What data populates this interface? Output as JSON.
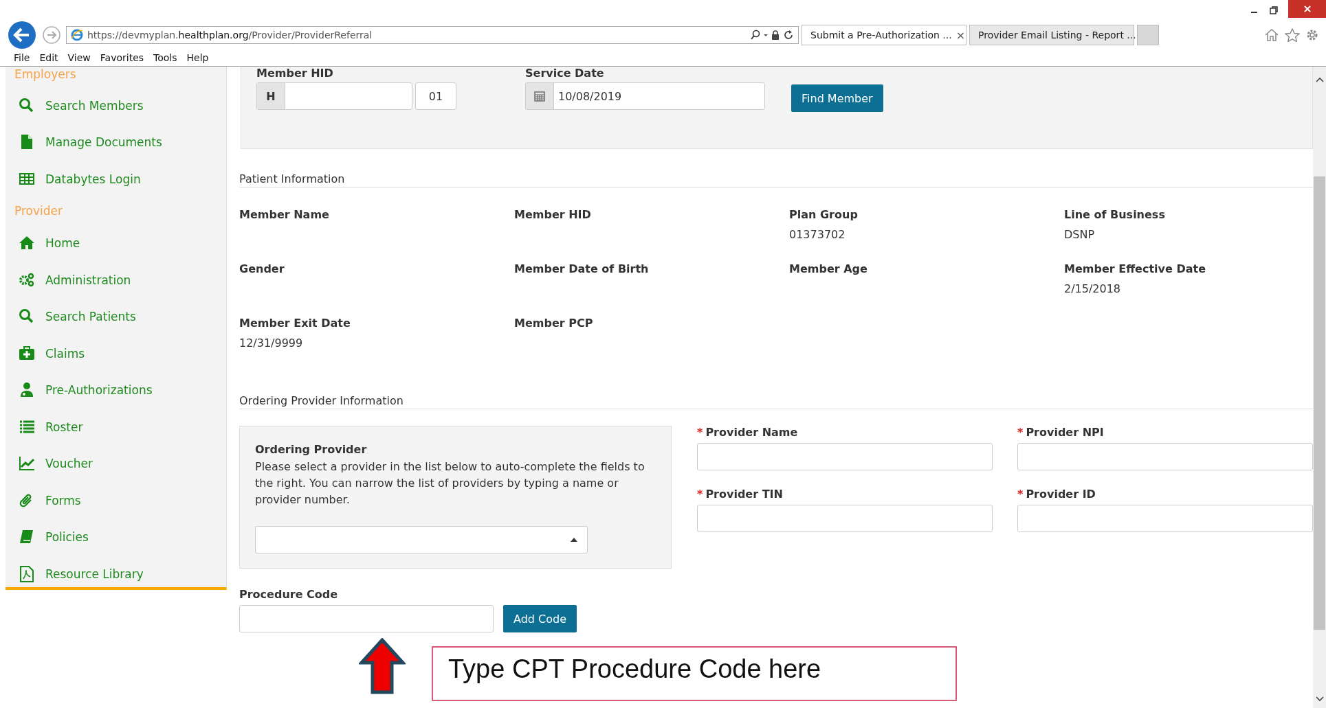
{
  "browser": {
    "url": "https://devmyplan.**healthplan.org**/Provider/ProviderReferral",
    "tabs": [
      {
        "title": "Submit a Pre-Authorization ...",
        "selected": true,
        "close": "×"
      },
      {
        "title": "Provider Email Listing - Report ...",
        "selected": false
      }
    ],
    "menu": [
      "File",
      "Edit",
      "View",
      "Favorites",
      "Tools",
      "Help"
    ]
  },
  "sidebar": {
    "sections": [
      {
        "heading": "Employers",
        "items": [
          "Search Members",
          "Manage Documents",
          "Databytes Login"
        ]
      },
      {
        "heading": "Provider",
        "items": [
          "Home",
          "Administration",
          "Search Patients",
          "Claims",
          "Pre-Authorizations",
          "Roster",
          "Voucher",
          "Forms",
          "Policies",
          "Resource Library"
        ]
      }
    ]
  },
  "member_search": {
    "hid_label": "Member HID",
    "hid_prefix": "H",
    "hid_suffix": "01",
    "date_label": "Service Date",
    "date_value": "10/08/2019",
    "button": "Find Member"
  },
  "patient_info": {
    "title": "Patient Information",
    "fields": [
      {
        "label": "Member Name"
      },
      {
        "label": "Member HID"
      },
      {
        "label": "Plan Group",
        "value": "01373702"
      },
      {
        "label": "Line of Business",
        "value": "DSNP"
      },
      {
        "label": "Gender"
      },
      {
        "label": "Member Date of Birth"
      },
      {
        "label": "Member Age"
      },
      {
        "label": "Member Effective Date",
        "value": "2/15/2018"
      },
      {
        "label": "Member Exit Date",
        "value": "12/31/9999"
      },
      {
        "label": "Member PCP"
      }
    ]
  },
  "ordering_provider": {
    "title": "Ordering Provider Information",
    "panel_title": "Ordering Provider",
    "description": "Please select a provider in the list below to auto-complete the fields to the right. You can narrow the list of providers by typing a name or provider number.",
    "fields": [
      {
        "label": "Provider Name",
        "mark": "*"
      },
      {
        "label": "Provider NPI",
        "mark": "*"
      },
      {
        "label": "Provider TIN",
        "mark": "*"
      },
      {
        "label": "Provider ID",
        "mark": "*"
      }
    ]
  },
  "procedure": {
    "label": "Procedure Code",
    "button": "Add Code"
  },
  "annotation": {
    "text": "Type CPT Procedure Code here"
  }
}
